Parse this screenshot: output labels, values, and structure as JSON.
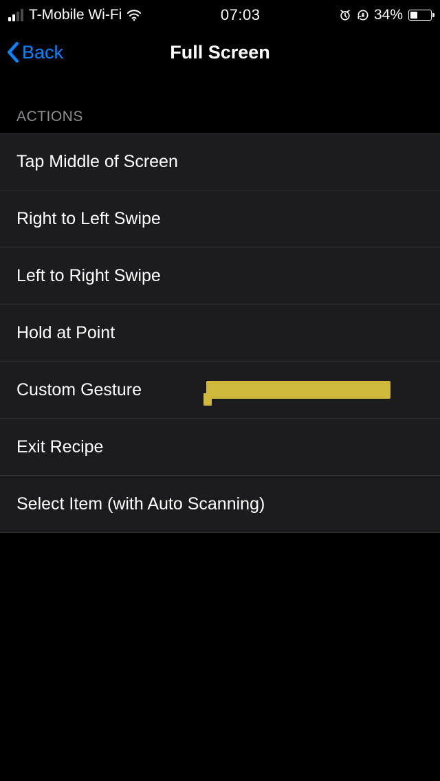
{
  "status_bar": {
    "carrier": "T-Mobile Wi-Fi",
    "time": "07:03",
    "battery_percent_label": "34%",
    "battery_fill_percent": 34
  },
  "nav": {
    "back_label": "Back",
    "title": "Full Screen"
  },
  "section": {
    "header": "ACTIONS",
    "items": [
      {
        "label": "Tap Middle of Screen"
      },
      {
        "label": "Right to Left Swipe"
      },
      {
        "label": "Left to Right Swipe"
      },
      {
        "label": "Hold at Point"
      },
      {
        "label": "Custom Gesture"
      },
      {
        "label": "Exit Recipe"
      },
      {
        "label": "Select Item (with Auto Scanning)"
      }
    ]
  }
}
